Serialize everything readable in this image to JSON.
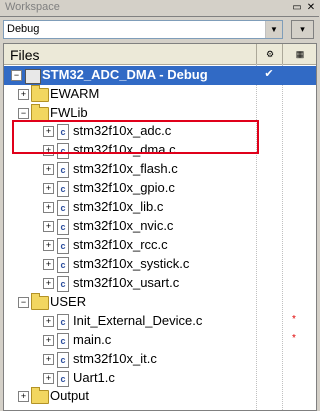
{
  "titlebar": {
    "title": "Workspace"
  },
  "config": {
    "value": "Debug"
  },
  "header": {
    "files": "Files"
  },
  "tree": {
    "root": {
      "label": "STM32_ADC_DMA - Debug",
      "check": "✔"
    },
    "groups": [
      {
        "label": "EWARM"
      },
      {
        "label": "FWLib"
      },
      {
        "label": "USER"
      },
      {
        "label": "Output"
      }
    ],
    "fwlib_files": [
      "stm32f10x_adc.c",
      "stm32f10x_dma.c",
      "stm32f10x_flash.c",
      "stm32f10x_gpio.c",
      "stm32f10x_lib.c",
      "stm32f10x_nvic.c",
      "stm32f10x_rcc.c",
      "stm32f10x_systick.c",
      "stm32f10x_usart.c"
    ],
    "user_files": [
      {
        "label": "Init_External_Device.c",
        "modified": "*"
      },
      {
        "label": "main.c",
        "modified": "*"
      },
      {
        "label": "stm32f10x_it.c",
        "modified": ""
      },
      {
        "label": "Uart1.c",
        "modified": ""
      }
    ]
  },
  "colors": {
    "selection": "#316ac5",
    "highlight_box": "#e0001a",
    "modified_star": "#e00000"
  }
}
